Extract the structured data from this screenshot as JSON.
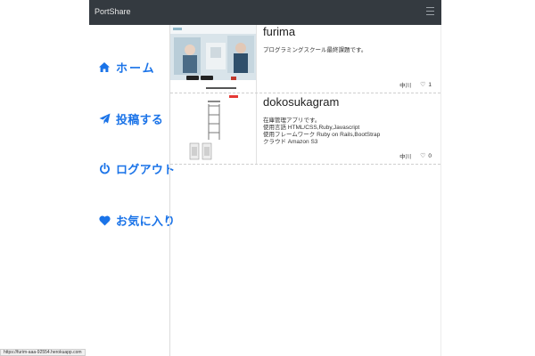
{
  "navbar": {
    "brand": "PortShare",
    "menu_icon": "hamburger-icon"
  },
  "sidebar": {
    "items": [
      {
        "label": "ホーム",
        "icon": "home-icon"
      },
      {
        "label": "投稿する",
        "icon": "paper-plane-icon"
      },
      {
        "label": "ログアウト",
        "icon": "power-icon"
      },
      {
        "label": "お気に入り",
        "icon": "heart-icon"
      }
    ],
    "accent_color": "#1a73e8"
  },
  "posts": [
    {
      "title": "furima",
      "description": [
        "プログラミングスクール最終課題です。"
      ],
      "author": "中川",
      "likes": "1"
    },
    {
      "title": "dokosukagram",
      "description": [
        "在庫管理アプリです。",
        "使用言語 HTML/CSS,Ruby,Javascript",
        "使用フレームワーク Ruby on Rails,BootStrap",
        "クラウド Amazon S3"
      ],
      "author": "中川",
      "likes": "0"
    }
  ],
  "status_url": "https://furim-aaa-92554.herokuapp.com"
}
